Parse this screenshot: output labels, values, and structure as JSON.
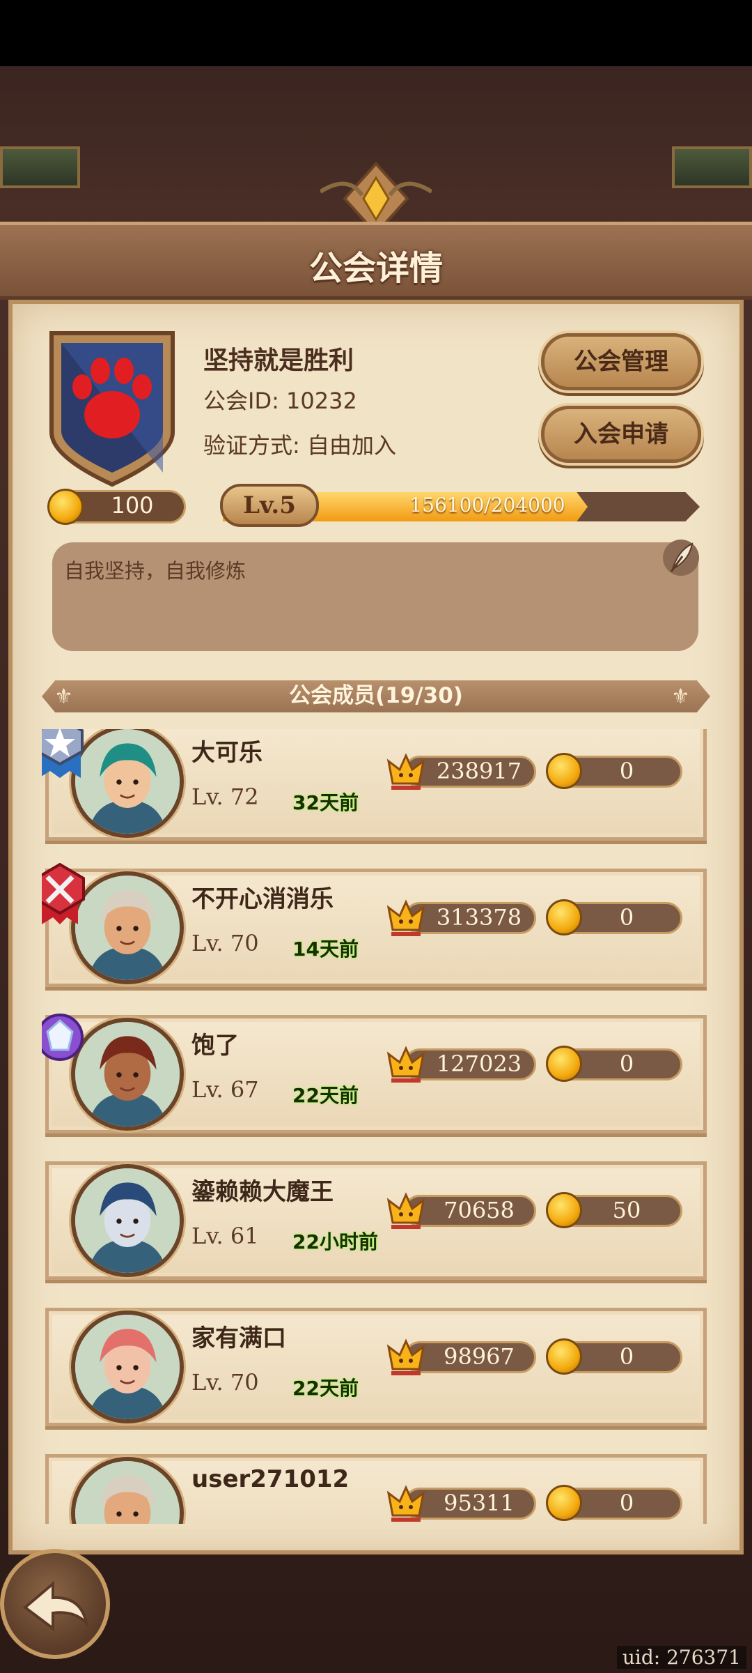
{
  "page": {
    "title": "公会详情",
    "uid_label": "uid: 276371"
  },
  "guild": {
    "name": "坚持就是胜利",
    "id_text": "公会ID: 10232",
    "join_text": "验证方式: 自由加入",
    "coins": "100",
    "level_label": "Lv.5",
    "exp_text": "156100/204000",
    "exp_fraction": 0.765,
    "motto": "自我坚持，自我修炼",
    "emblem_icon": "bear-paw-icon"
  },
  "buttons": {
    "manage": "公会管理",
    "apply": "入会申请"
  },
  "members_header": "公会成员(19/30)",
  "members": [
    {
      "name": "大可乐",
      "level": "Lv. 72",
      "last_seen": "32天前",
      "power": "238917",
      "coins": "0",
      "badge": "star-rank-icon",
      "hair": "#1f8f86",
      "skin": "#f0c39a"
    },
    {
      "name": "不开心消消乐",
      "level": "Lv. 70",
      "last_seen": "14天前",
      "power": "313378",
      "coins": "0",
      "badge": "crossed-swords-icon",
      "hair": "#d9cfc0",
      "skin": "#e3a97c"
    },
    {
      "name": "饱了",
      "level": "Lv. 67",
      "last_seen": "22天前",
      "power": "127023",
      "coins": "0",
      "badge": "gem-icon",
      "hair": "#7a2a1a",
      "skin": "#b06a44"
    },
    {
      "name": "鎏赖赖大魔王",
      "level": "Lv. 61",
      "last_seen": "22小时前",
      "power": "70658",
      "coins": "50",
      "badge": "",
      "hair": "#2a4a7a",
      "skin": "#d9e0ea"
    },
    {
      "name": "家有满口",
      "level": "Lv. 70",
      "last_seen": "22天前",
      "power": "98967",
      "coins": "0",
      "badge": "",
      "hair": "#e3706a",
      "skin": "#f2c2a8"
    },
    {
      "name": "user271012",
      "level": "",
      "last_seen": "",
      "power": "95311",
      "coins": "0",
      "badge": "",
      "hair": "#d9cfc0",
      "skin": "#e3a97c"
    }
  ],
  "colors": {
    "panel_bg": "#f1e3c6",
    "title_bar": "#8a5f43",
    "accent_gold": "#f29b13",
    "online_green": "#a8ff6a"
  }
}
